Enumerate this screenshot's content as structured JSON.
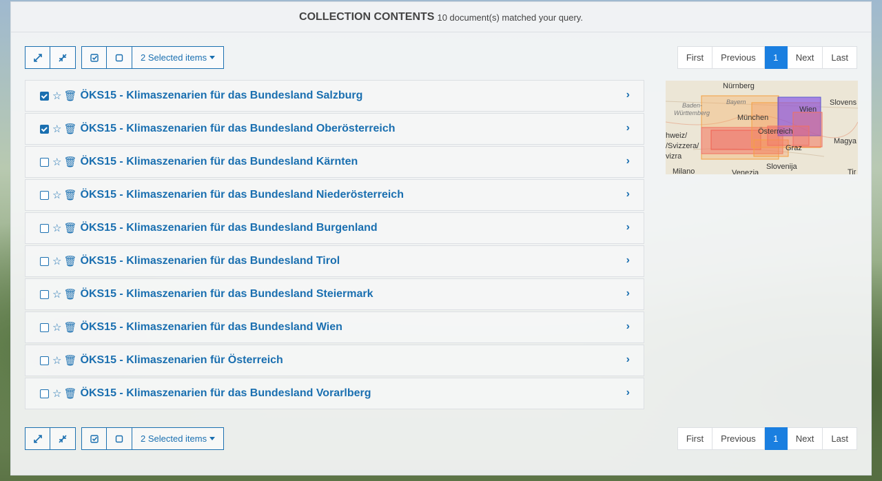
{
  "header": {
    "title": "COLLECTION CONTENTS",
    "subtitle": "10 document(s) matched your query."
  },
  "toolbar": {
    "expand_icon": "expand-icon",
    "collapse_icon": "compress-icon",
    "select_all_icon": "check-square-icon",
    "select_none_icon": "square-icon",
    "selected_label": "2 Selected items"
  },
  "pagination": {
    "first": "First",
    "previous": "Previous",
    "current": "1",
    "next": "Next",
    "last": "Last"
  },
  "items": [
    {
      "title": "ÖKS15 - Klimaszenarien für das Bundesland Salzburg",
      "checked": true
    },
    {
      "title": "ÖKS15 - Klimaszenarien für das Bundesland Oberösterreich",
      "checked": true
    },
    {
      "title": "ÖKS15 - Klimaszenarien für das Bundesland Kärnten",
      "checked": false
    },
    {
      "title": "ÖKS15 - Klimaszenarien für das Bundesland Niederösterreich",
      "checked": false
    },
    {
      "title": "ÖKS15 - Klimaszenarien für das Bundesland Burgenland",
      "checked": false
    },
    {
      "title": "ÖKS15 - Klimaszenarien für das Bundesland Tirol",
      "checked": false
    },
    {
      "title": "ÖKS15 - Klimaszenarien für das Bundesland Steiermark",
      "checked": false
    },
    {
      "title": "ÖKS15 - Klimaszenarien für das Bundesland Wien",
      "checked": false
    },
    {
      "title": "ÖKS15 - Klimaszenarien für Österreich",
      "checked": false
    },
    {
      "title": "ÖKS15 - Klimaszenarien für das Bundesland Vorarlberg",
      "checked": false
    }
  ],
  "map": {
    "labels": {
      "nurnberg": "Nürnberg",
      "bayern": "Bayern",
      "baden": "Baden-",
      "wurttemberg": "Württemberg",
      "munchen": "München",
      "wien": "Wien",
      "slovens": "Slovens",
      "osterreich": "Österreich",
      "magya": "Magya",
      "schweiz1": "hweiz/",
      "schweiz2": "/Svizzera/",
      "schweiz3": "vizra",
      "graz": "Graz",
      "slovenija": "Slovenija",
      "milano": "Milano",
      "venezia": "Venezia",
      "tir": "Tir"
    }
  }
}
